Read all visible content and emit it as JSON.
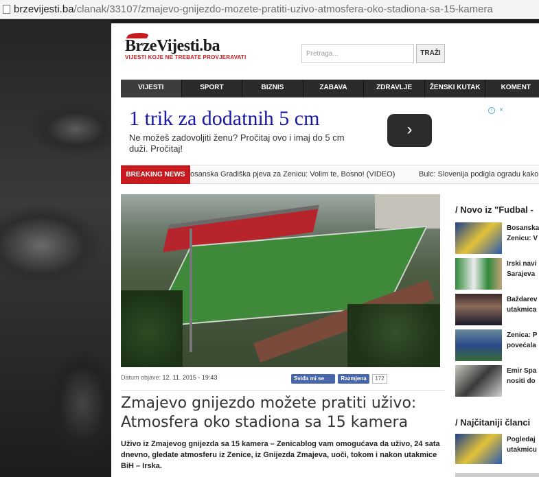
{
  "browser": {
    "url_host": "brzevijesti.ba",
    "url_path": "/clanak/33107/zmajevo-gnijezdo-mozete-pratiti-uzivo-atmosfera-oko-stadiona-sa-15-kamera"
  },
  "header": {
    "brand_prefix": "Brze",
    "brand_suffix": "Vijesti.ba",
    "tagline": "VIJESTI KOJE NE TREBATE PROVJERAVATI",
    "search_placeholder": "Pretraga...",
    "search_button": "TRAŽI"
  },
  "nav": {
    "items": [
      "VIJESTI",
      "SPORT",
      "BIZNIS",
      "ZABAVA",
      "ZDRAVLJE",
      "ŽENSKI KUTAK",
      "KOMENT"
    ]
  },
  "ad": {
    "headline": "1 trik za dodatnih 5 cm",
    "body": "Ne možeš zadovoljiti ženu? Pročitaj ovo i imaj do 5 cm duži. Pročitaj!",
    "arrow": "›",
    "info_icon": "i",
    "close_icon": "×"
  },
  "breaking": {
    "label": "BREAKING NEWS",
    "item1": "osanska Gradiška pjeva za Zenicu: Volim te, Bosno! (VIDEO)",
    "item2": "Bulc: Slovenija podigla ogradu kako"
  },
  "article": {
    "date_label": "Datum objave:",
    "date_value": "12. 11. 2015 - 19:43",
    "fb_like": "Sviđa mi se",
    "share": "Razmjena",
    "share_count": "172",
    "title": "Zmajevo gnijezdo možete pratiti uživo: Atmosfera oko stadiona sa 15 kamera",
    "lead": "Uživo iz Zmajevog gnijezda sa 15 kamera – Zenicablog vam omogućava da uživo, 24 sata dnevno, gledate atmosferu iz Zenice, iz Gnijezda Zmajeva, uoči, tokom i nakon utakmice BiH – Irska."
  },
  "sidebar": {
    "heading1": "/ Novo iz \"Fudbal -",
    "items": [
      {
        "line1": "Bosanska",
        "line2": "Zenicu: V"
      },
      {
        "line1": "Irski navi",
        "line2": "Sarajeva"
      },
      {
        "line1": "Baždarev",
        "line2": "utakmica"
      },
      {
        "line1": "Zenica: P",
        "line2": "povećala"
      },
      {
        "line1": "Emir Spa",
        "line2": "nositi do"
      }
    ],
    "heading2": "/ Najčitaniji članci",
    "item2_line1": "Pogledaj",
    "item2_line2": "utakmicu"
  }
}
